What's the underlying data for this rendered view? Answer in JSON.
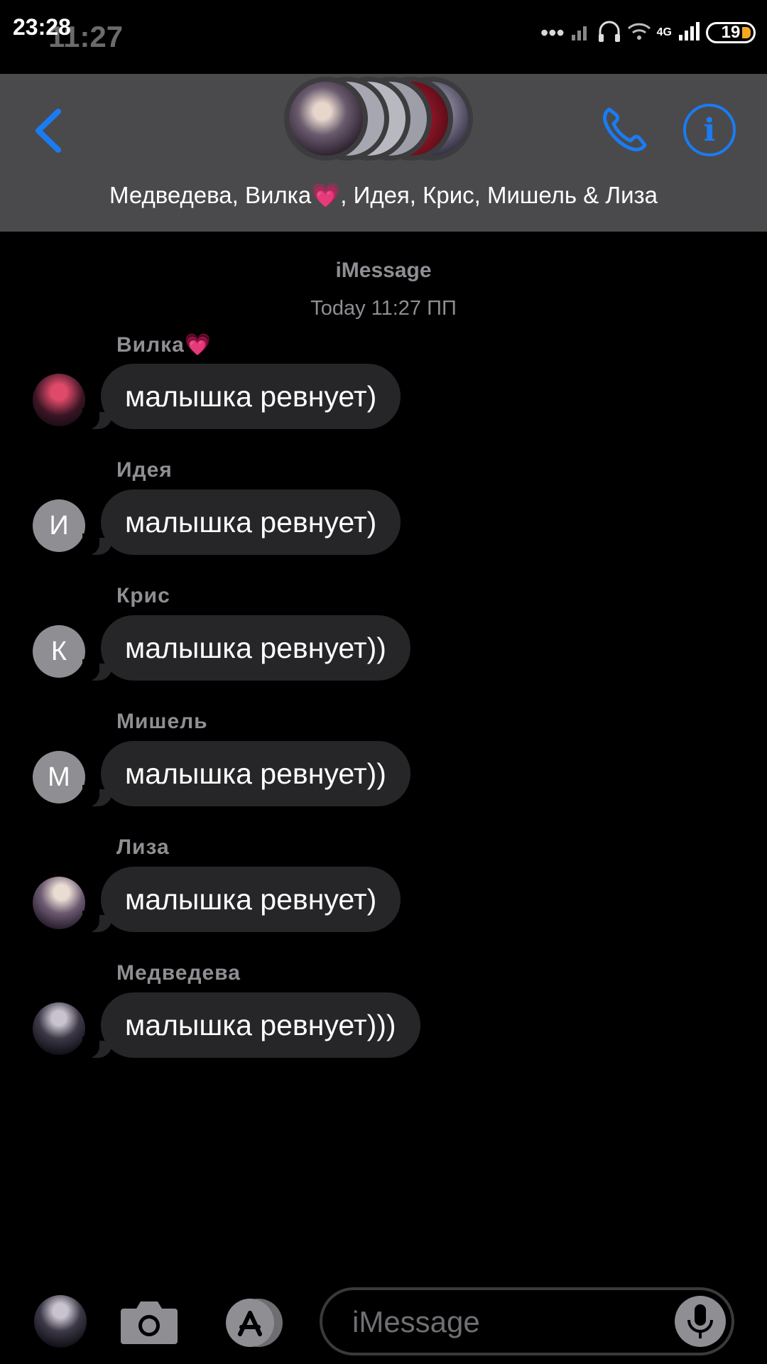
{
  "status_bar": {
    "time_back": "11:27",
    "time_front": "23:28",
    "network": "4G",
    "battery": "19"
  },
  "header": {
    "group_title": "Медведева, Вилка💗, Идея, Крис, Мишель & Лиза"
  },
  "meta": {
    "service": "iMessage",
    "timestamp": "Today 11:27 ПП"
  },
  "messages": [
    {
      "sender": "Вилка💗",
      "text": "малышка ревнует)",
      "avatar": "photo"
    },
    {
      "sender": "Идея",
      "text": "малышка ревнует)",
      "avatar_initial": "И"
    },
    {
      "sender": "Крис",
      "text": "малышка ревнует))",
      "avatar_initial": "К"
    },
    {
      "sender": "Мишель",
      "text": "малышка ревнует))",
      "avatar_initial": "М"
    },
    {
      "sender": "Лиза",
      "text": "малышка ревнует)",
      "avatar": "photo"
    },
    {
      "sender": "Медведева",
      "text": "малышка ревнует)))",
      "avatar": "photo"
    }
  ],
  "composer": {
    "placeholder": "iMessage"
  },
  "colors": {
    "accent": "#1a7cf2",
    "header_bg": "#4a4a4c",
    "bubble": "#262628",
    "secondary_text": "#8e8e93"
  },
  "icons": [
    "back-chevron-icon",
    "phone-icon",
    "info-icon",
    "camera-icon",
    "appstore-icon",
    "microphone-icon",
    "signal-icon",
    "wifi-icon",
    "headphones-icon"
  ]
}
